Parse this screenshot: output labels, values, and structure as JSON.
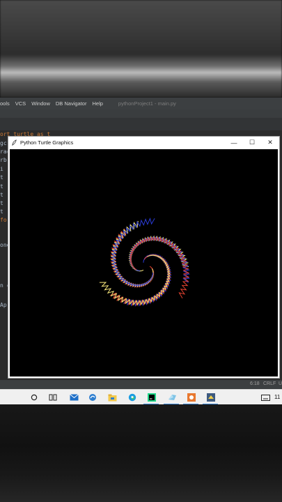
{
  "ide": {
    "menu": [
      "ools",
      "VCS",
      "Window",
      "DB Navigator",
      "Help"
    ],
    "project_title": "pythonProject1 - main.py",
    "code_fragments": [
      "ort turtle as t",
      "gc",
      "rac",
      "rb",
      "i",
      "t",
      "t",
      "t",
      "t",
      "t",
      "fo",
      "one",
      "n c",
      "Ap"
    ],
    "status_position": "6:18",
    "status_line_ending": "CRLF",
    "status_extra": "U"
  },
  "turtle_window": {
    "title": "Python Turtle Graphics",
    "minimize_symbol": "—",
    "maximize_symbol": "☐",
    "close_symbol": "✕"
  },
  "taskbar": {
    "icons": [
      "search-circle-icon",
      "task-view-icon",
      "mail-icon",
      "edge-legacy-icon",
      "file-explorer-icon",
      "edge-icon",
      "pycharm-icon",
      "azure-data-studio-icon",
      "paint-icon",
      "python-turtle-icon"
    ],
    "tray_text": "11"
  },
  "colors": {
    "spiral_red": "#e0402f",
    "spiral_yellow": "#f2e27a",
    "spiral_blue": "#2a3bd6",
    "canvas_bg": "#000000",
    "accent": "#3c87d6"
  }
}
